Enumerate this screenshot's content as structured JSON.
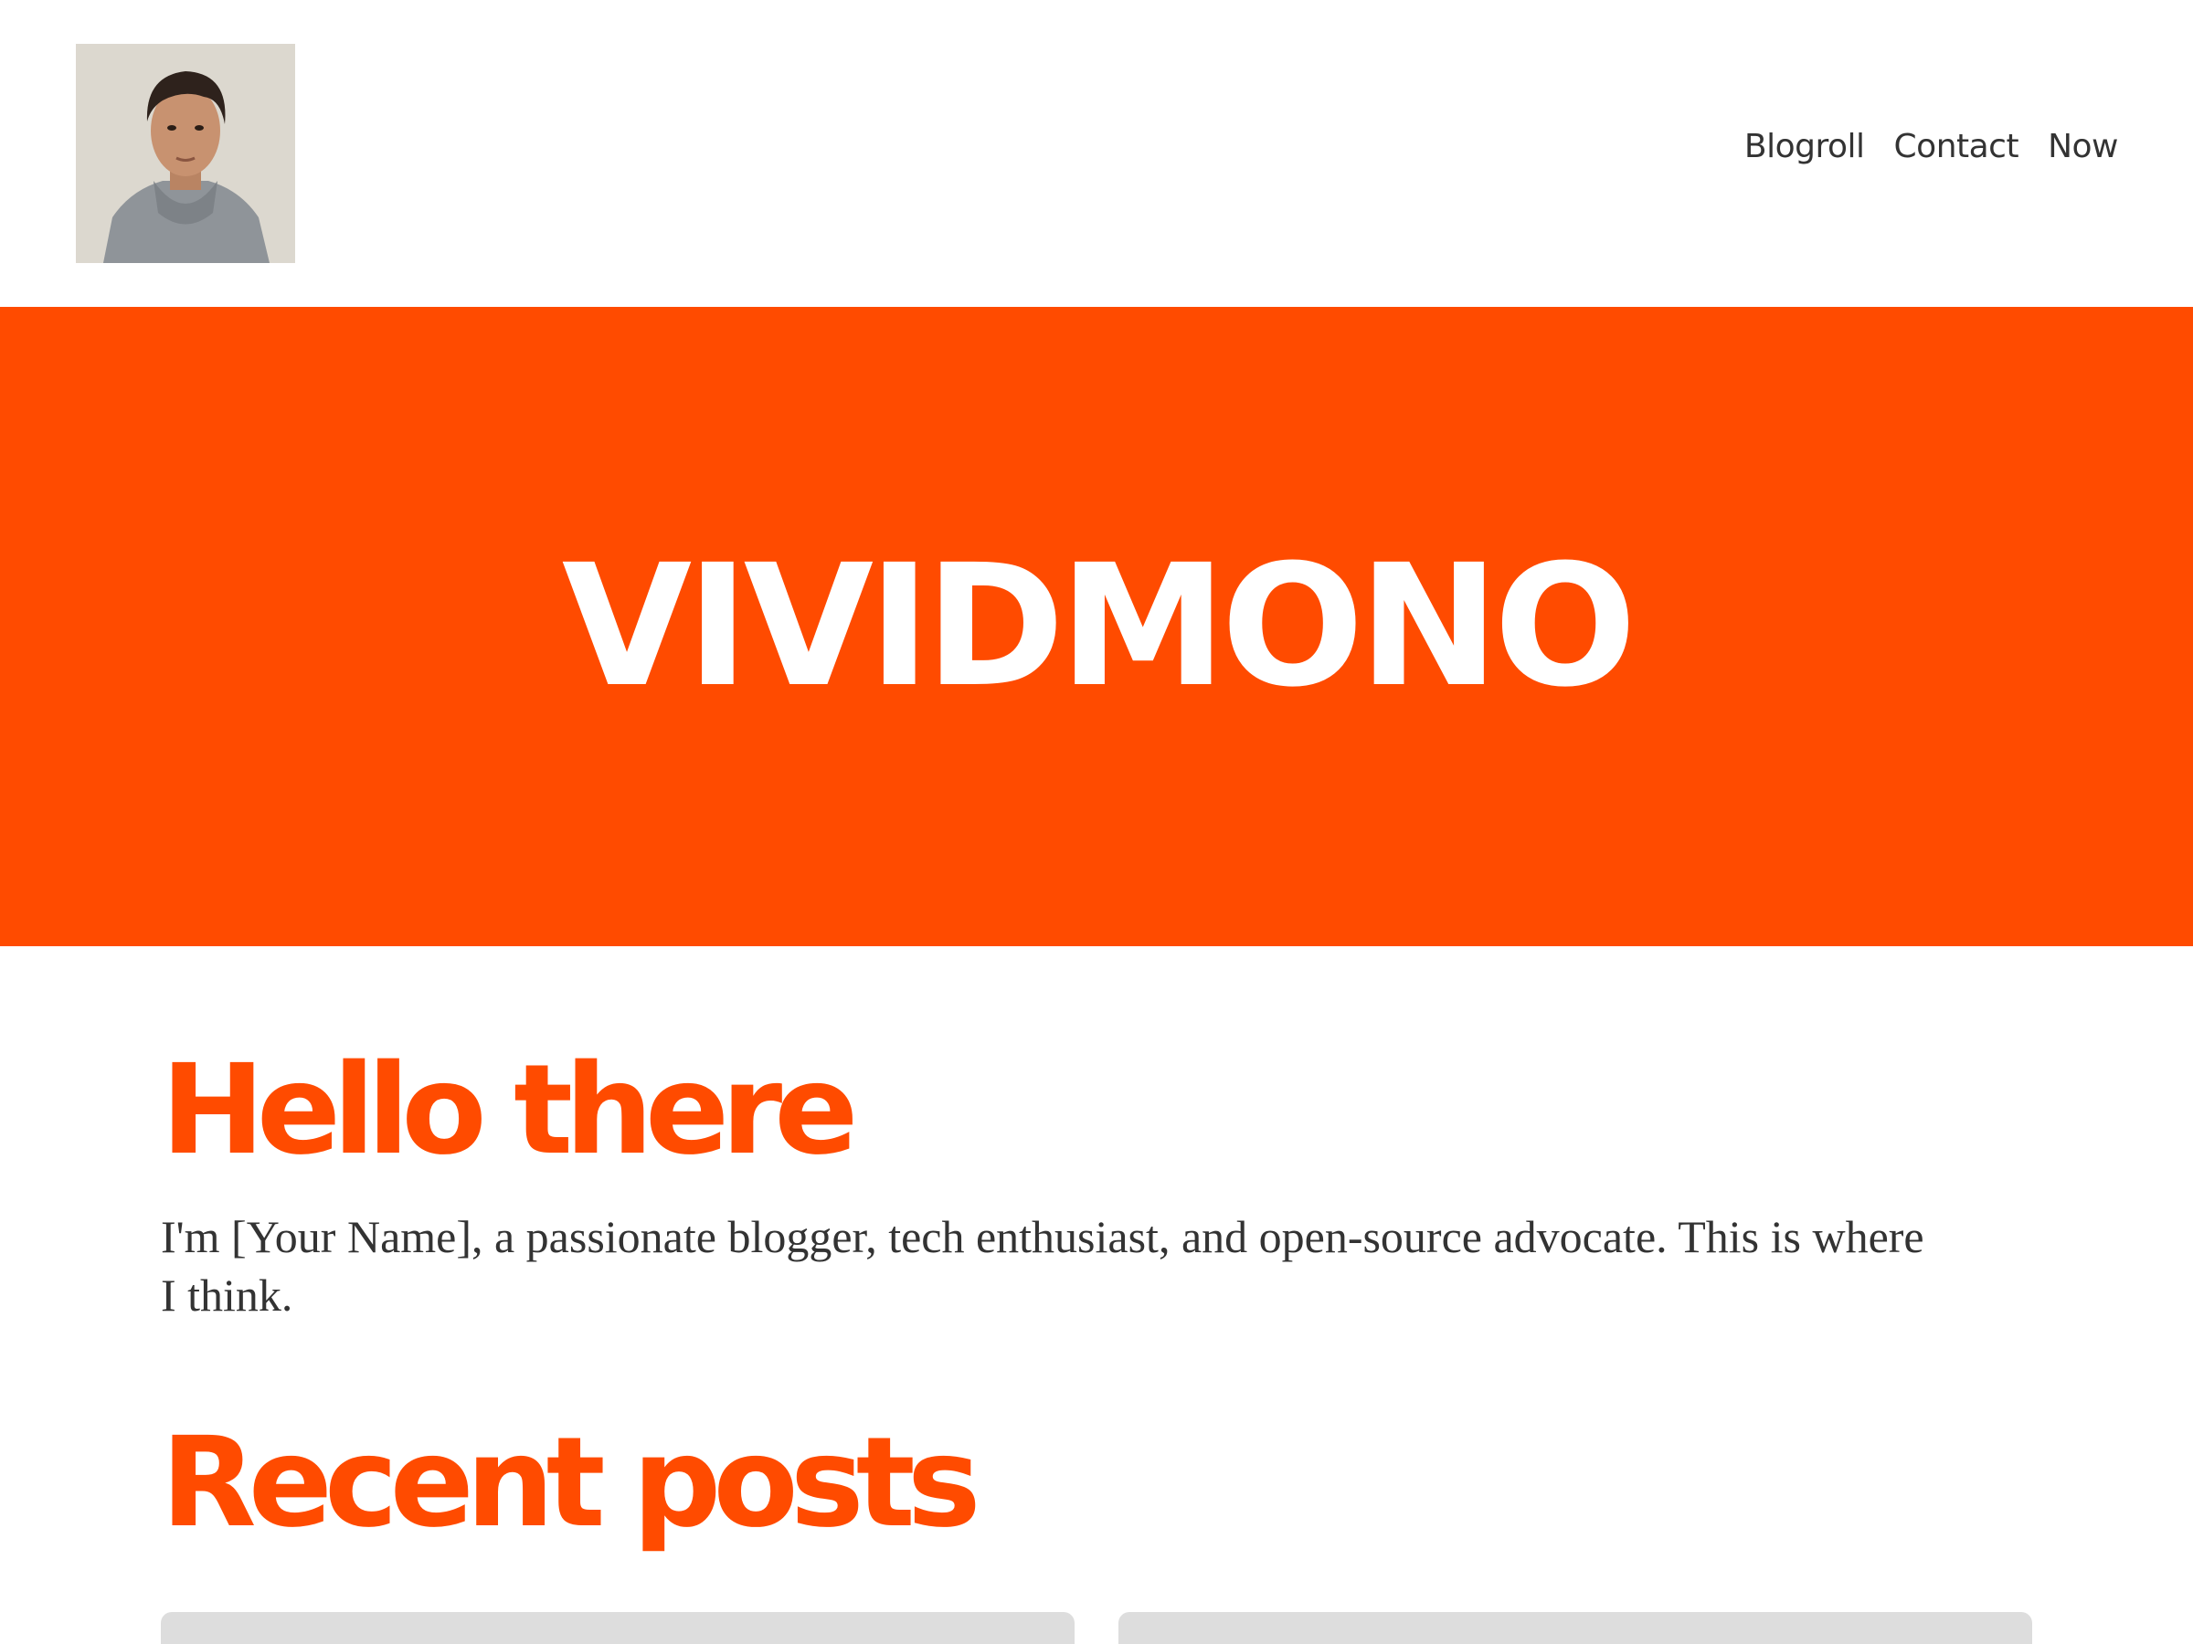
{
  "header": {
    "nav": [
      {
        "label": "Blogroll"
      },
      {
        "label": "Contact"
      },
      {
        "label": "Now"
      }
    ]
  },
  "hero": {
    "title": "VIVIDMONO"
  },
  "intro": {
    "heading": "Hello there",
    "text": "I'm [Your Name], a passionate blogger, tech enthusiast, and open-source advocate. This is where I think."
  },
  "recent_posts": {
    "heading": "Recent posts"
  },
  "theme": {
    "accent": "#ff4b00",
    "text": "#333333",
    "card_placeholder": "#dddddd"
  },
  "icons": {
    "avatar": "profile-photo"
  }
}
